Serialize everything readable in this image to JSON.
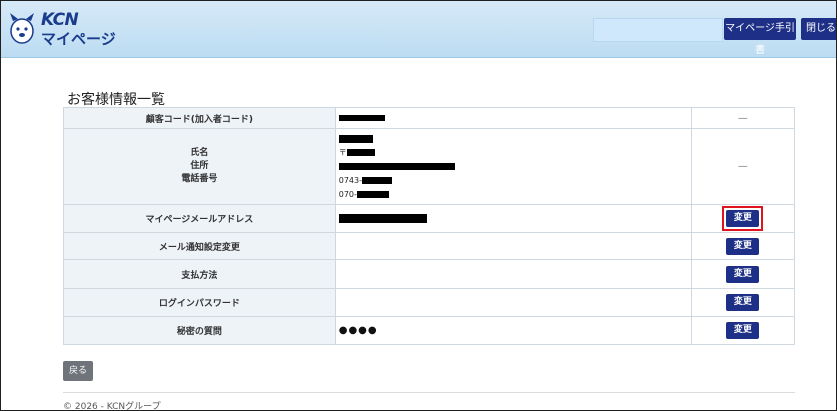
{
  "header": {
    "logo_brand": "KCN",
    "logo_sub": "マイページ",
    "guide_button": "マイページ手引書",
    "close_button": "閉じる"
  },
  "main": {
    "title": "お客様情報一覧",
    "rows": [
      {
        "label": "顧客コード(加入者コード)",
        "action": "—"
      },
      {
        "labels": [
          "氏名",
          "住所",
          "電話番号"
        ],
        "postal_prefix": "〒",
        "phone1_prefix": "0743-",
        "phone2_prefix": "070-",
        "action": "—"
      },
      {
        "label": "マイページメールアドレス",
        "action": "変更"
      },
      {
        "label": "メール通知設定変更",
        "action": "変更"
      },
      {
        "label": "支払方法",
        "action": "変更"
      },
      {
        "label": "ログインパスワード",
        "action": "変更"
      },
      {
        "label": "秘密の質問",
        "value": "●●●●",
        "action": "変更"
      }
    ],
    "back_button": "戻る"
  },
  "footer": {
    "copyright": "© 2026 - KCNグループ"
  },
  "colors": {
    "header_bg": "#c7e2f5",
    "button_navy": "#1d2f86",
    "highlight_red": "#e0141e",
    "label_bg": "#eef3f8"
  }
}
